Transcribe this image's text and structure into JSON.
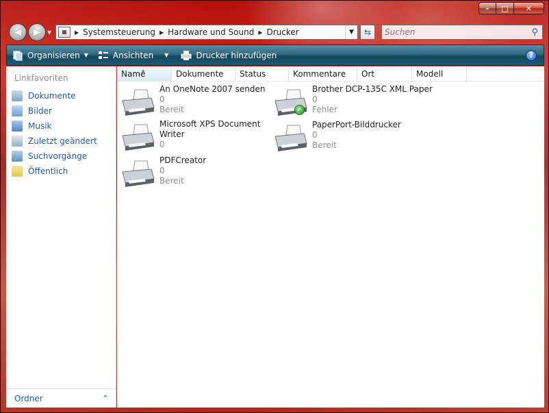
{
  "window": {
    "caption": {
      "minimize": "–",
      "maximize": "□",
      "close": "✕"
    }
  },
  "addressbar": {
    "crumbs": [
      "Systemsteuerung",
      "Hardware und Sound",
      "Drucker"
    ],
    "search_placeholder": "Suchen"
  },
  "toolbar": {
    "organize": "Organisieren",
    "views": "Ansichten",
    "add_printer": "Drucker hinzufügen",
    "help": "?"
  },
  "navpane": {
    "heading": "Linkfavoriten",
    "items": [
      {
        "label": "Dokumente",
        "icon": "documents-icon",
        "color": "#7fa7c9"
      },
      {
        "label": "Bilder",
        "icon": "pictures-icon",
        "color": "#6b9fd1"
      },
      {
        "label": "Musik",
        "icon": "music-icon",
        "color": "#4d86c5"
      },
      {
        "label": "Zuletzt geändert",
        "icon": "recent-icon",
        "color": "#8fb0cc"
      },
      {
        "label": "Suchvorgänge",
        "icon": "searches-icon",
        "color": "#5a95b8"
      },
      {
        "label": "Öffentlich",
        "icon": "public-folder-icon",
        "color": "#e8c34a"
      }
    ],
    "footer": "Ordner"
  },
  "columns": [
    "Name",
    "Dokumente",
    "Status",
    "Kommentare",
    "Ort",
    "Modell"
  ],
  "printers": [
    {
      "name": "An OneNote 2007 senden",
      "name2": "",
      "docs": "0",
      "status": "Bereit",
      "default": false
    },
    {
      "name": "Brother DCP-135C XML Paper",
      "name2": "",
      "docs": "0",
      "status": "Fehler",
      "default": true
    },
    {
      "name": "Microsoft XPS Document",
      "name2": "Writer",
      "docs": "0",
      "status": "",
      "default": false
    },
    {
      "name": "PaperPort-Bilddrucker",
      "name2": "",
      "docs": "0",
      "status": "Bereit",
      "default": false
    },
    {
      "name": "PDFCreator",
      "name2": "",
      "docs": "0",
      "status": "Bereit",
      "default": false
    }
  ]
}
